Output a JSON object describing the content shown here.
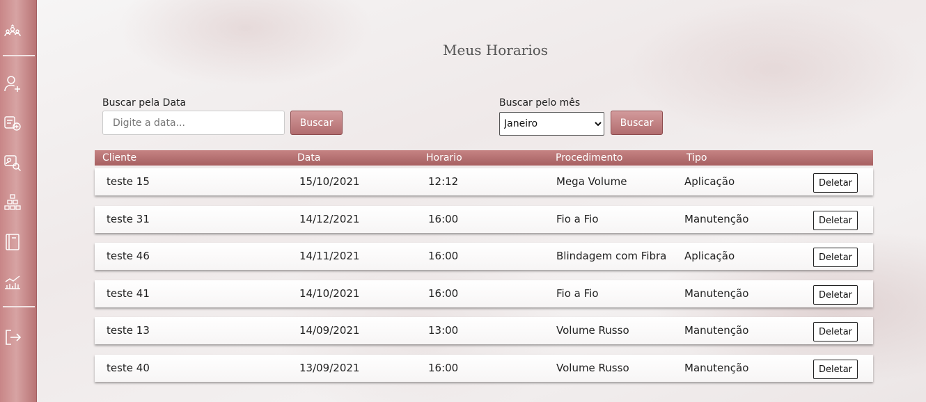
{
  "sidebar": {
    "icons": [
      "users-group-icon",
      "add-user-icon",
      "add-service-icon",
      "search-client-icon",
      "hierarchy-icon",
      "book-icon",
      "chart-icon",
      "logout-icon"
    ]
  },
  "page": {
    "title": "Meus Horarios"
  },
  "search_date": {
    "label": "Buscar pela Data",
    "placeholder": "Digite a data...",
    "button_label": "Buscar"
  },
  "search_month": {
    "label": "Buscar pelo mês",
    "selected": "Janeiro",
    "button_label": "Buscar"
  },
  "table": {
    "headers": {
      "cliente": "Cliente",
      "data": "Data",
      "horario": "Horario",
      "procedimento": "Procedimento",
      "tipo": "Tipo"
    },
    "delete_label": "Deletar",
    "rows": [
      {
        "cliente": "teste 15",
        "data": "15/10/2021",
        "horario": "12:12",
        "procedimento": "Mega Volume",
        "tipo": "Aplicação"
      },
      {
        "cliente": "teste 31",
        "data": "14/12/2021",
        "horario": "16:00",
        "procedimento": "Fio a Fio",
        "tipo": "Manutenção"
      },
      {
        "cliente": "teste 46",
        "data": "14/11/2021",
        "horario": "16:00",
        "procedimento": "Blindagem com Fibra",
        "tipo": "Aplicação"
      },
      {
        "cliente": "teste 41",
        "data": "14/10/2021",
        "horario": "16:00",
        "procedimento": "Fio a Fio",
        "tipo": "Manutenção"
      },
      {
        "cliente": "teste 13",
        "data": "14/09/2021",
        "horario": "13:00",
        "procedimento": "Volume Russo",
        "tipo": "Manutenção"
      },
      {
        "cliente": "teste 40",
        "data": "13/09/2021",
        "horario": "16:00",
        "procedimento": "Volume Russo",
        "tipo": "Manutenção"
      }
    ]
  }
}
